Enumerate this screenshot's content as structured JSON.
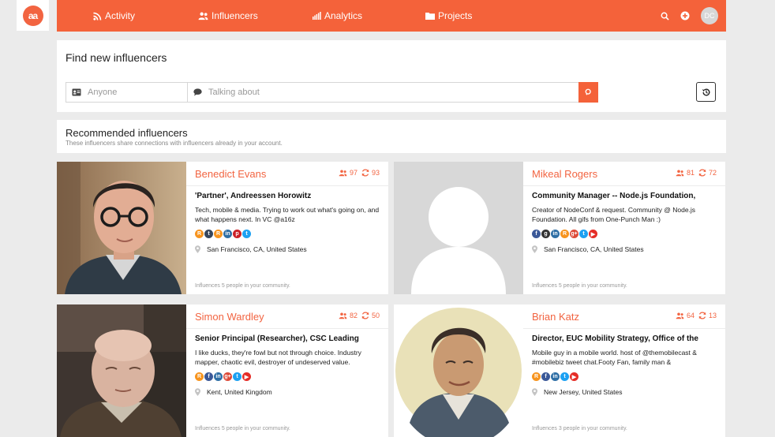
{
  "nav": {
    "logo_text": "aa",
    "activity": "Activity",
    "influencers": "Influencers",
    "analytics": "Analytics",
    "projects": "Projects",
    "user_initials": "DC"
  },
  "find": {
    "title": "Find new influencers",
    "who_placeholder": "Anyone",
    "what_placeholder": "Talking about"
  },
  "recommended": {
    "title": "Recommended influencers",
    "subtitle": "These influencers share connections with influencers already in your account."
  },
  "colors": {
    "accent": "#f4623a",
    "name": "#f26441"
  },
  "cards": [
    {
      "name": "Benedict Evans",
      "followers": "97",
      "reach": "93",
      "role": "'Partner', Andreessen Horowitz",
      "bio": "Tech, mobile & media. Trying to work out what's going on, and what happens next. In VC @a16z",
      "location": "San Francisco, CA, United States",
      "footer": "Influences 5 people in your community.",
      "social": [
        "rss",
        "tumblr",
        "rss",
        "linkedin",
        "pinterest",
        "twitter"
      ]
    },
    {
      "name": "Mikeal Rogers",
      "followers": "81",
      "reach": "72",
      "role": "Community Manager -- Node.js Foundation,",
      "bio": "Creator of NodeConf & request. Community @ Node.js Foundation. All gifs from One-Punch Man :)",
      "location": "San Francisco, CA, United States",
      "footer": "Influences 5 people in your community.",
      "social": [
        "facebook",
        "github",
        "linkedin",
        "rss",
        "google-plus",
        "twitter",
        "youtube"
      ]
    },
    {
      "name": "Simon Wardley",
      "followers": "82",
      "reach": "50",
      "role": "Senior Principal (Researcher), CSC Leading",
      "bio": "I like ducks, they're fowl but not through choice. Industry mapper, chaotic evil, destroyer of undeserved value.",
      "location": "Kent, United Kingdom",
      "footer": "Influences 5 people in your community.",
      "social": [
        "rss",
        "facebook",
        "linkedin",
        "google-plus",
        "twitter",
        "youtube"
      ]
    },
    {
      "name": "Brian Katz",
      "followers": "64",
      "reach": "13",
      "role": "Director, EUC Mobility Strategy, Office of the",
      "bio": "Mobile guy in a mobile world. host of @themobilecast & #mobilebiz tweet chat.Footy Fan, family man &",
      "location": "New Jersey, United States",
      "footer": "Influences 3 people in your community.",
      "social": [
        "rss",
        "facebook",
        "linkedin",
        "twitter",
        "youtube"
      ]
    }
  ]
}
